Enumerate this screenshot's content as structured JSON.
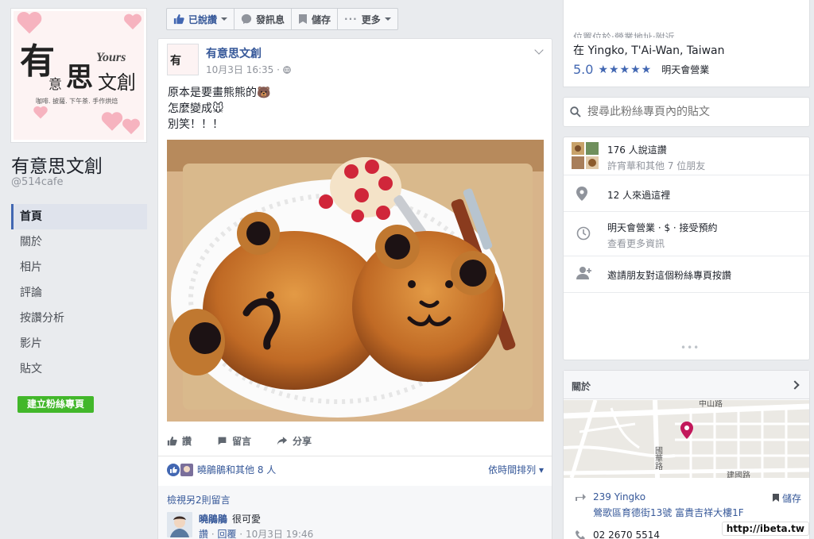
{
  "page": {
    "name": "有意思文創",
    "handle": "@514cafe",
    "logo": {
      "main_char": "有",
      "small_char": "意",
      "si": "思",
      "wenchuang": "文創",
      "yours": "Yours",
      "tagline": "咖啡. 披薩. 下午茶. 手作烘焙"
    }
  },
  "left_nav": {
    "items": [
      {
        "label": "首頁",
        "active": true
      },
      {
        "label": "關於"
      },
      {
        "label": "相片"
      },
      {
        "label": "評論"
      },
      {
        "label": "按讚分析"
      },
      {
        "label": "影片"
      },
      {
        "label": "貼文"
      }
    ],
    "create_page": "建立粉絲專頁"
  },
  "action_bar": {
    "liked": "已說讚",
    "message": "發訊息",
    "save": "儲存",
    "more": "更多"
  },
  "post": {
    "author": "有意思文創",
    "time": "10月3日 16:35 · ",
    "lines": [
      "原本是要畫熊熊的🐻",
      "怎麼變成🐭",
      "別笑！！！"
    ],
    "actions": {
      "like": "讚",
      "comment": "留言",
      "share": "分享"
    },
    "reactions_text": "曉鵑鵑和其他 8 人",
    "sort": "依時間排列 ▾",
    "more_comments": "檢視另2則留言",
    "comment": {
      "author": "曉鵑鵑",
      "text": "很可愛",
      "like": "讚",
      "reply": "回覆",
      "time": "10月3日 19:46"
    }
  },
  "right": {
    "location_cut": "位置位於‧營業地址‧附近",
    "location": "在 Yingko, T'Ai-Wan, Taiwan",
    "rating": "5.0",
    "stars": "★★★★★",
    "open": "明天會營業",
    "search_placeholder": "搜尋此粉絲專頁內的貼文",
    "likes_main": "176 人說這讚",
    "likes_sub": "許宵華和其他 7 位朋友",
    "visits": "12 人來過這裡",
    "hours_main": "明天會營業 · $ · 接受預約",
    "hours_sub": "查看更多資訊",
    "invite": "邀請朋友對這個粉絲專頁按讚",
    "dots": "•••",
    "about_title": "關於",
    "map_labels": {
      "road1": "中山路",
      "road2": "國華路",
      "road3": "建國路"
    },
    "addr_1": "239 Yingko",
    "addr_2": "鶯歌區育德街13號 富貴吉祥大樓1F",
    "save": "儲存",
    "phone": "02 2670 5514"
  },
  "watermark": "http://ibeta.tw",
  "colors": {
    "fb_blue": "#4267b2",
    "link_blue": "#365899",
    "green_button": "#42b72a",
    "background": "#e9ebee"
  }
}
